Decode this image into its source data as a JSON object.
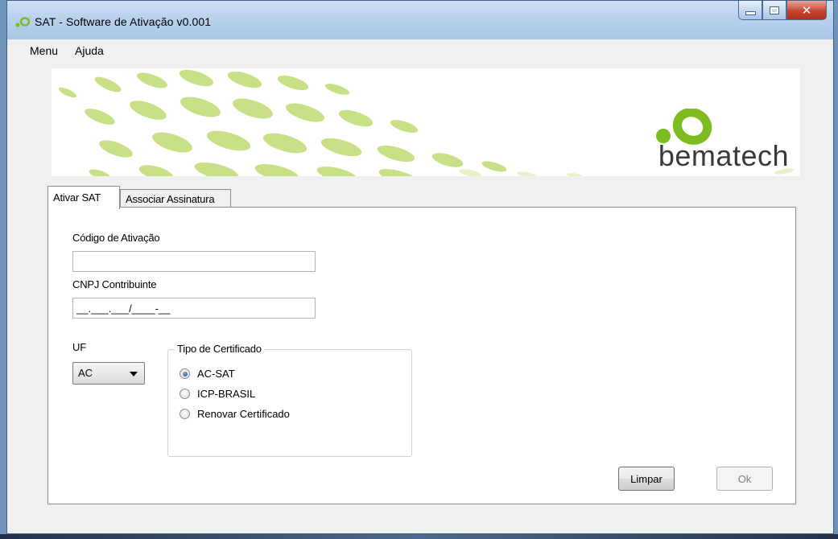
{
  "window": {
    "title": "SAT - Software de Ativação v0.001",
    "accent_color": "#7dbb1e",
    "controls": {
      "minimize": "minimize-icon",
      "maximize": "maximize-icon",
      "close": "close-icon"
    }
  },
  "menu": {
    "items": [
      {
        "label": "Menu"
      },
      {
        "label": "Ajuda"
      }
    ]
  },
  "banner": {
    "logo_text": "bematech",
    "logo_color": "#7dbb1e"
  },
  "tabs": [
    {
      "label": "Ativar SAT",
      "active": true
    },
    {
      "label": "Associar Assinatura",
      "active": false
    }
  ],
  "form": {
    "codigo_label": "Código de Ativação",
    "codigo_value": "",
    "cnpj_label": "CNPJ Contribuinte",
    "cnpj_value": "__.___.___/____-__",
    "uf_label": "UF",
    "uf_value": "AC",
    "tipo_label": "Tipo de Certificado",
    "radios": [
      {
        "label": "AC-SAT",
        "checked": true
      },
      {
        "label": "ICP-BRASIL",
        "checked": false
      },
      {
        "label": "Renovar Certificado",
        "checked": false
      }
    ]
  },
  "buttons": {
    "limpar": "Limpar",
    "ok": "Ok"
  }
}
